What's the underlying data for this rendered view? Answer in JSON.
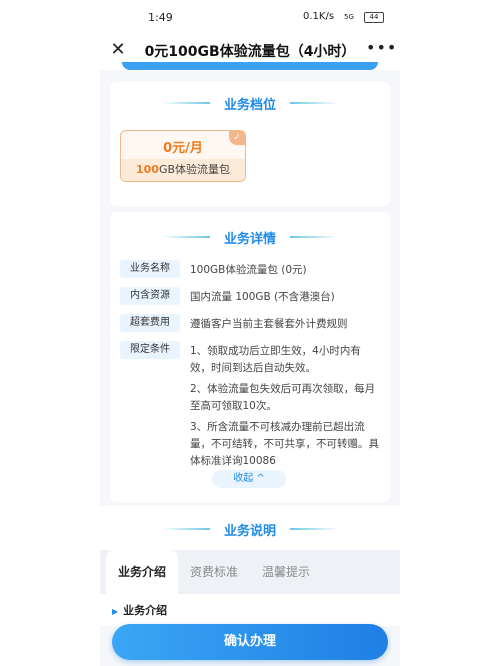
{
  "status_bar": {
    "time": "1:49",
    "network_speed": "0.1K/s",
    "signal": "5G",
    "battery": "44"
  },
  "nav": {
    "close_symbol": "✕",
    "title": "0元100GB体验流量包（4小时）",
    "more_symbol": "•••"
  },
  "plan_section": {
    "title": "业务档位",
    "plan": {
      "price": "0元/月",
      "name_highlight": "100",
      "name_rest": "GB体验流量包",
      "check_symbol": "✓"
    }
  },
  "detail_section": {
    "title": "业务详情",
    "rows": [
      {
        "label": "业务名称",
        "value": "100GB体验流量包 (0元)"
      },
      {
        "label": "内含资源",
        "value": "国内流量 100GB (不含港澳台)"
      },
      {
        "label": "超套费用",
        "value": "遵循客户当前主套餐套外计费规则"
      },
      {
        "label": "限定条件",
        "lines": [
          "1、领取成功后立即生效，4小时内有效，时间到达后自动失效。",
          "2、体验流量包失效后可再次领取，每月至高可领取10次。",
          "3、所含流量不可核减办理前已超出流量，不可结转，不可共享，不可转赠。具体标准详询10086"
        ]
      }
    ],
    "collapse_label": "收起 ^"
  },
  "desc_section": {
    "title": "业务说明",
    "tabs": [
      {
        "label": "业务介绍",
        "active": true
      },
      {
        "label": "资费标准",
        "active": false
      },
      {
        "label": "温馨提示",
        "active": false
      }
    ],
    "subheading": "业务介绍"
  },
  "confirm_button": "确认办理",
  "colors": {
    "accent": "#1f8be6",
    "orange": "#f07a1e",
    "button": "#2f93ee"
  }
}
